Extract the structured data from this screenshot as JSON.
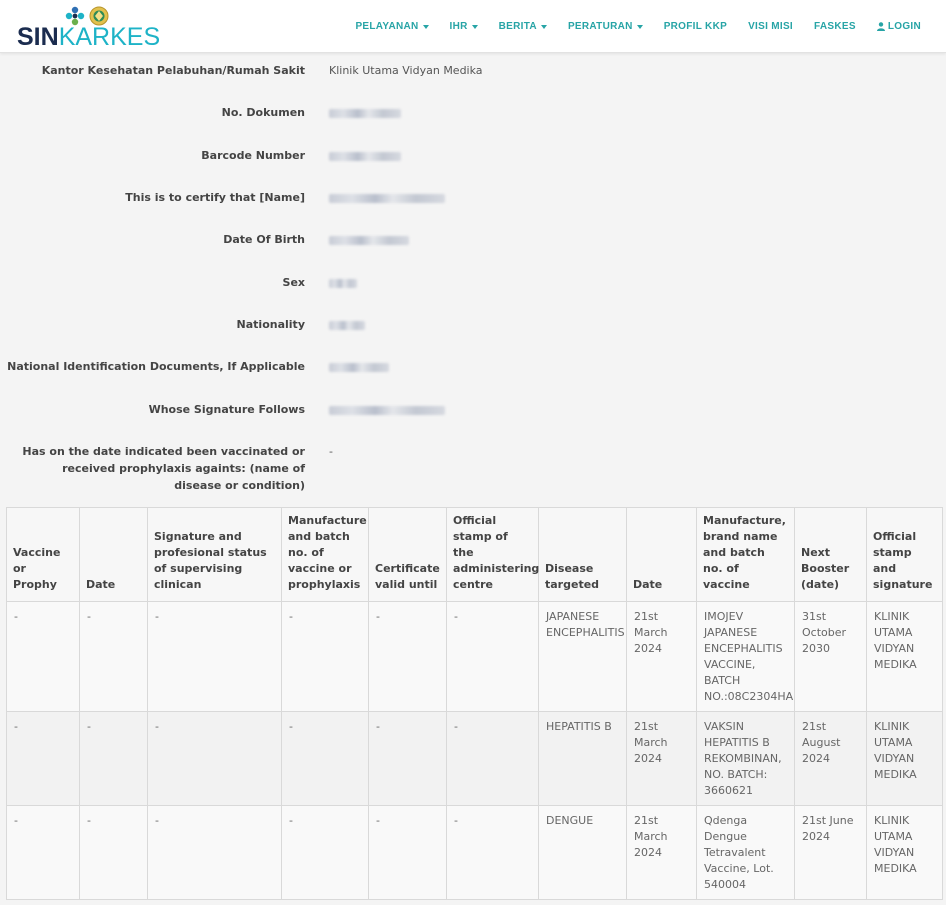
{
  "brand": {
    "logo_text_1": "SIN",
    "logo_text_2": "KARKES",
    "colors": {
      "dark": "#1b2c4f",
      "teal": "#1eb3c7",
      "nav": "#27a4a6"
    }
  },
  "nav": {
    "items": [
      {
        "label": "PELAYANAN",
        "dropdown": true
      },
      {
        "label": "IHR",
        "dropdown": true
      },
      {
        "label": "BERITA",
        "dropdown": true
      },
      {
        "label": "PERATURAN",
        "dropdown": true
      },
      {
        "label": "PROFIL KKP",
        "dropdown": false
      },
      {
        "label": "VISI MISI",
        "dropdown": false
      },
      {
        "label": "FASKES",
        "dropdown": false
      }
    ],
    "login_label": "LOGIN",
    "login_icon": "user-icon"
  },
  "fields": {
    "kantor": {
      "label": "Kantor Kesehatan Pelabuhan/Rumah Sakit",
      "value": "Klinik Utama Vidyan Medika"
    },
    "no_dokumen": {
      "label": "No. Dokumen"
    },
    "barcode": {
      "label": "Barcode Number"
    },
    "name": {
      "label": "This is to certify that [Name]"
    },
    "dob": {
      "label": "Date Of Birth"
    },
    "sex": {
      "label": "Sex"
    },
    "nationality": {
      "label": "Nationality"
    },
    "national_id": {
      "label": "National Identification Documents, If Applicable"
    },
    "signature": {
      "label": "Whose Signature Follows"
    },
    "vaccinated": {
      "label": "Has on the date indicated been vaccinated or received prophylaxis againts: (name of disease or condition)",
      "value": "-"
    }
  },
  "table": {
    "headers": [
      "Vaccine or Prophy",
      "Date",
      "Signature and profesional status of supervising clinican",
      "Manufacture and batch no. of vaccine or prophylaxis",
      "Certificate valid until",
      "Official stamp of the administering centre",
      "Disease targeted",
      "Date",
      "Manufacture, brand name and batch no. of vaccine",
      "Next Booster (date)",
      "Official stamp and signature"
    ],
    "rows": [
      [
        "-",
        "-",
        "-",
        "-",
        "-",
        "-",
        "JAPANESE ENCEPHALITIS",
        "21st March 2024",
        "IMOJEV JAPANESE ENCEPHALITIS VACCINE, BATCH NO.:08C2304HA",
        "31st October 2030",
        "KLINIK UTAMA VIDYAN MEDIKA"
      ],
      [
        "-",
        "-",
        "-",
        "-",
        "-",
        "-",
        "HEPATITIS B",
        "21st March 2024",
        "VAKSIN HEPATITIS B REKOMBINAN, NO. BATCH: 3660621",
        "21st August 2024",
        "KLINIK UTAMA VIDYAN MEDIKA"
      ],
      [
        "-",
        "-",
        "-",
        "-",
        "-",
        "-",
        "DENGUE",
        "21st March 2024",
        "Qdenga Dengue Tetravalent Vaccine, Lot. 540004",
        "21st June 2024",
        "KLINIK UTAMA VIDYAN MEDIKA"
      ]
    ]
  }
}
